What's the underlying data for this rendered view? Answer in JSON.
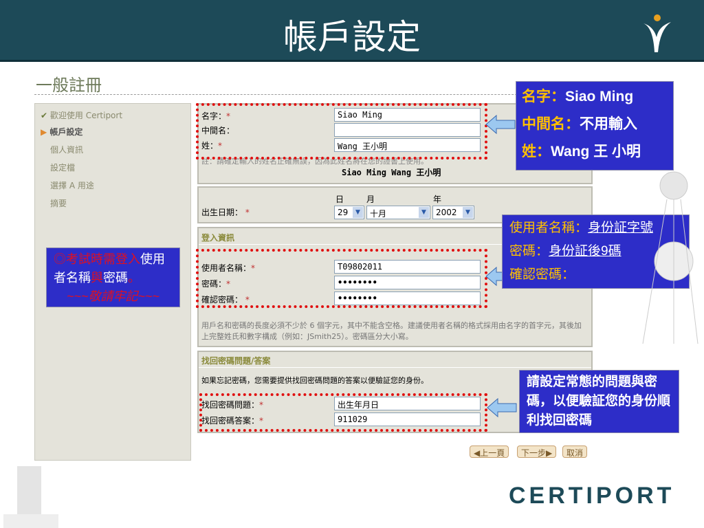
{
  "header": {
    "title": "帳戶設定"
  },
  "page_title": "一般註冊",
  "sidebar": {
    "items": [
      {
        "label": "歡迎使用 Certiport"
      },
      {
        "label": "帳戶設定"
      },
      {
        "label": "個人資訊"
      },
      {
        "label": "設定檔"
      },
      {
        "label": "選擇 A 用途"
      },
      {
        "label": "摘要"
      }
    ]
  },
  "name_section": {
    "first_label": "名字：",
    "middle_label": "中間名：",
    "last_label": "姓：",
    "first_value": "Siao Ming",
    "middle_value": "",
    "last_value": "Wang 王小明",
    "note": "註：請確定輸入的姓名正確無誤，因為此姓名將在您的證書上使用。",
    "preview": "Siao Ming Wang 王小明"
  },
  "dob": {
    "label": "出生日期：",
    "day_label": "日",
    "month_label": "月",
    "year_label": "年",
    "day": "29",
    "month": "十月",
    "year": "2002"
  },
  "login": {
    "header": "登入資訊",
    "username_label": "使用者名稱：",
    "password_label": "密碼：",
    "confirm_label": "確認密碼：",
    "username": "T09802011",
    "password": "••••••••",
    "confirm": "••••••••",
    "note": "用戶名和密碼的長度必須不少於 6 個字元，其中不能含空格。建議使用者名稱的格式採用由名字的首字元，其後加上完整姓氏和數字構成（例如：JSmith25）。密碼區分大小寫。"
  },
  "security": {
    "header": "找回密碼問題/答案",
    "intro": "如果忘記密碼，您需要提供找回密碼問題的答案以便驗証您的身份。",
    "question_label": "找回密碼問題：",
    "answer_label": "找回密碼答案：",
    "question": "出生年月日",
    "answer": "911029"
  },
  "buttons": {
    "prev": "◀上一頁",
    "next": "下一步▶",
    "cancel": "取消"
  },
  "required_mark": "*",
  "callouts": {
    "name": {
      "l1a": "名字：",
      "l1b": "Siao Ming",
      "l2a": "中間名：",
      "l2b": "不用輸入",
      "l3a": "姓：",
      "l3b": "Wang 王 小明"
    },
    "login": {
      "l1a": "使用者名稱：",
      "l1b": "身份証字號",
      "l2a": "密碼：",
      "l2b": "身份証後9碼",
      "l3a": "確認密碼："
    },
    "security": "請設定常態的問題與密碼，以便驗証您的身份順利找回密碼",
    "left": {
      "a": "◎考試時需登入",
      "b": "使用者名稱",
      "c": "與",
      "d": "密碼",
      "e": "。",
      "f": "~~~敬請牢記~~~"
    }
  },
  "brand": "CERTIPORT"
}
